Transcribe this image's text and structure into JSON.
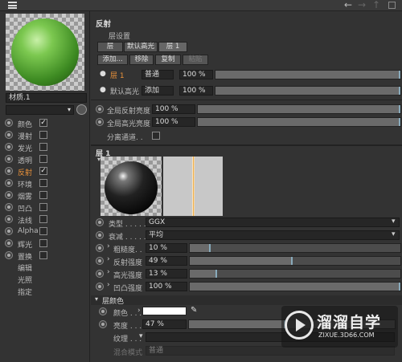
{
  "material": {
    "name": "材质.1"
  },
  "channels": [
    {
      "label": "颜色",
      "checked": true
    },
    {
      "label": "漫射",
      "checked": false
    },
    {
      "label": "发光",
      "checked": false
    },
    {
      "label": "透明",
      "checked": false
    },
    {
      "label": "反射",
      "checked": true
    },
    {
      "label": "环境",
      "checked": false
    },
    {
      "label": "烟雾",
      "checked": false
    },
    {
      "label": "凹凸",
      "checked": false
    },
    {
      "label": "法线",
      "checked": false
    },
    {
      "label": "Alpha",
      "checked": false
    },
    {
      "label": "辉光",
      "checked": false
    },
    {
      "label": "置换",
      "checked": false
    }
  ],
  "extra_items": [
    "编辑",
    "光照",
    "指定"
  ],
  "reflectance": {
    "title": "反射",
    "layer_settings": "层设置",
    "tabs": [
      "层",
      "默认高光",
      "层 1"
    ],
    "actions": [
      "添加...",
      "移除",
      "复制",
      "粘贴"
    ],
    "layers": [
      {
        "name": "层 1",
        "mode": "普通",
        "value": "100 %",
        "fraction": 1.0
      },
      {
        "name": "默认高光",
        "mode": "添加",
        "value": "100 %",
        "fraction": 1.0
      }
    ],
    "global_reflect": {
      "label": "全局反射亮度",
      "value": "100 %",
      "fraction": 1.0
    },
    "global_spec": {
      "label": "全局高光亮度",
      "value": "100 %",
      "fraction": 1.0
    },
    "separate_pass": "分离通道. ."
  },
  "layer1": {
    "title": "层 1",
    "type": {
      "label": "类型 . . . . .",
      "value": "GGX"
    },
    "attenuation": {
      "label": "衰减 . . . . .",
      "value": "平均"
    },
    "params": [
      {
        "label": "粗糙度. .",
        "value": "10 %",
        "fraction": 0.1
      },
      {
        "label": "反射强度",
        "value": "49 %",
        "fraction": 0.49
      },
      {
        "label": "高光强度",
        "value": "13 %",
        "fraction": 0.13
      },
      {
        "label": "凹凸强度",
        "value": "100 %",
        "fraction": 1.0
      }
    ]
  },
  "layer_color": {
    "title": "层颜色",
    "color_label": "颜色 . . .",
    "color_hex": "#ffffff",
    "brightness_label": "亮度 . . .",
    "brightness_value": "47 %",
    "brightness_fraction": 0.47,
    "texture_label": "纹理 . . .",
    "blend_mode_label": "混合模式",
    "blend_mode_value": "普通"
  },
  "watermark": {
    "title": "溜溜自学",
    "subtitle": "ZIXUE.3D66.COM"
  }
}
